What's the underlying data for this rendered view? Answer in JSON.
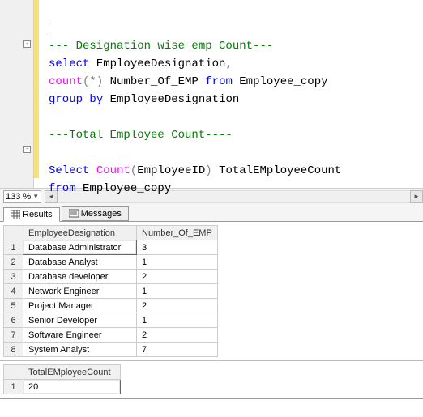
{
  "zoom": {
    "value": "133 %"
  },
  "code": {
    "comment1": "--- Designation wise emp Count---",
    "kw_select1": "select",
    "ident_design1": "EmployeeDesignation",
    "comma1": ",",
    "func_count1": "count",
    "paren_open1": "(",
    "star1": "*",
    "paren_close1": ")",
    "ident_numemp": "Number_Of_EMP",
    "kw_from1": "from",
    "ident_table1": "Employee_copy",
    "kw_group": "group",
    "kw_by": "by",
    "ident_design2": "EmployeeDesignation",
    "comment2": "---Total Employee Count----",
    "kw_select2": "Select",
    "func_count2": "Count",
    "paren_open2": "(",
    "ident_empid": "EmployeeID",
    "paren_close2": ")",
    "ident_total": "TotalEMployeeCount",
    "kw_from2": "from",
    "ident_table2": "Employee_copy"
  },
  "tabs": {
    "results": "Results",
    "messages": "Messages"
  },
  "grid1": {
    "headers": [
      "EmployeeDesignation",
      "Number_Of_EMP"
    ],
    "rows": [
      [
        "Database Administrator",
        "3"
      ],
      [
        "Database Analyst",
        "1"
      ],
      [
        "Database developer",
        "2"
      ],
      [
        "Network Engineer",
        "1"
      ],
      [
        "Project Manager",
        "2"
      ],
      [
        "Senior Developer",
        "1"
      ],
      [
        "Software Engineer",
        "2"
      ],
      [
        "System Analyst",
        "7"
      ]
    ]
  },
  "grid2": {
    "headers": [
      "TotalEMployeeCount"
    ],
    "rows": [
      [
        "20"
      ]
    ]
  }
}
